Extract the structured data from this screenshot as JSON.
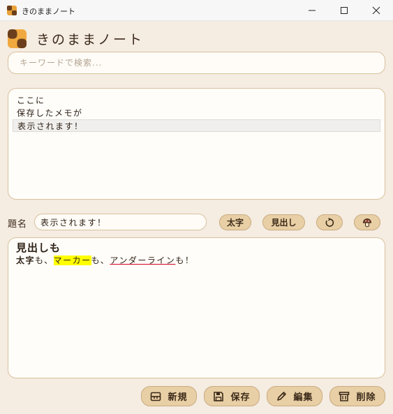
{
  "window": {
    "title": "きのままノート",
    "controls": {
      "minimize": "minimize-icon",
      "maximize": "maximize-icon",
      "close": "close-icon"
    }
  },
  "header": {
    "app_name": "きのままノート",
    "logo": "checker-logo-icon"
  },
  "search": {
    "placeholder": "キーワードで検索...",
    "value": ""
  },
  "memo_list": {
    "items": [
      {
        "label": "ここに",
        "selected": false
      },
      {
        "label": "保存したメモが",
        "selected": false
      },
      {
        "label": "表示されます！",
        "selected": true
      }
    ]
  },
  "title_field": {
    "label": "題名",
    "value": "表示されます！"
  },
  "format_buttons": {
    "bold_label": "太字",
    "heading_label": "見出し",
    "rotate_icon": "rotate-icon",
    "mushroom_icon": "mushroom-icon"
  },
  "editor": {
    "heading": "見出しも",
    "line": {
      "bold": "太字",
      "sep1": "も、",
      "marker": "マーカー",
      "sep2": "も、",
      "underline": "アンダーライン",
      "end": "も！"
    }
  },
  "actions": {
    "new_label": "新規",
    "save_label": "保存",
    "edit_label": "編集",
    "delete_label": "削除"
  },
  "colors": {
    "background": "#f5ece2",
    "button": "#e8cfa5",
    "border": "#d8c29e",
    "marker": "#ffff00",
    "underline": "#d0021b"
  }
}
